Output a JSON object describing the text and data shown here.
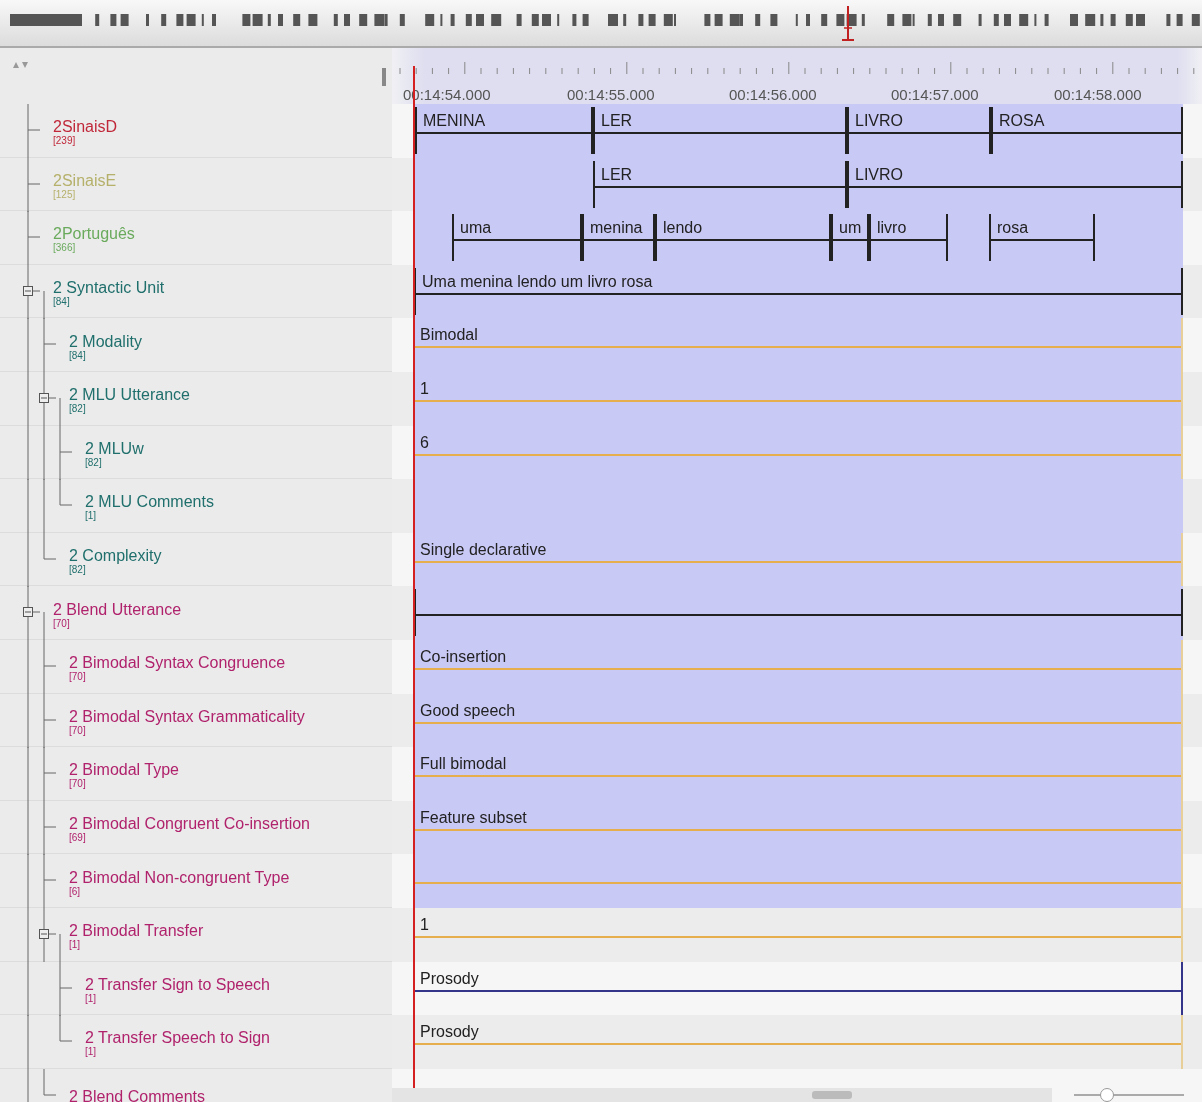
{
  "timeline": {
    "times": [
      "00:14:54.000",
      "00:14:55.000",
      "00:14:56.000",
      "00:14:57.000",
      "00:14:58.000"
    ]
  },
  "tiers": [
    {
      "name": "2SinaisD",
      "count": "[239]",
      "color": "#c0283a",
      "highlighted": true,
      "kind": "aligned",
      "annotations": [
        {
          "value": "MENINA"
        },
        {
          "value": "LER"
        },
        {
          "value": "LIVRO"
        },
        {
          "value": "ROSA"
        }
      ]
    },
    {
      "name": "2SinaisE",
      "count": "[125]",
      "color": "#b5b06a",
      "highlighted": true,
      "kind": "aligned",
      "annotations": [
        {
          "value": "LER"
        },
        {
          "value": "LIVRO"
        }
      ]
    },
    {
      "name": "2Português",
      "count": "[366]",
      "color": "#6aaa5c",
      "highlighted": true,
      "kind": "aligned",
      "annotations": [
        {
          "value": "uma"
        },
        {
          "value": "menina"
        },
        {
          "value": "lendo"
        },
        {
          "value": "um"
        },
        {
          "value": "livro"
        },
        {
          "value": "rosa"
        }
      ]
    },
    {
      "name": "2 Syntactic Unit",
      "count": "[84]",
      "color": "#1f6f6c",
      "highlighted": true,
      "kind": "aligned",
      "expanded": true,
      "annotations": [
        {
          "value": "Uma menina lendo um livro rosa"
        }
      ],
      "children": [
        {
          "name": "2 Modality",
          "count": "[84]",
          "color": "#1f6f6c",
          "highlighted": true,
          "kind": "reference",
          "annotations": [
            {
              "value": "Bimodal"
            }
          ]
        },
        {
          "name": "2 MLU Utterance",
          "count": "[82]",
          "color": "#1f6f6c",
          "highlighted": true,
          "kind": "reference",
          "expanded": true,
          "annotations": [
            {
              "value": "1"
            }
          ],
          "children": [
            {
              "name": "2 MLUw",
              "count": "[82]",
              "color": "#1f6f6c",
              "highlighted": true,
              "kind": "reference",
              "annotations": [
                {
                  "value": "6"
                }
              ]
            },
            {
              "name": "2 MLU Comments",
              "count": "[1]",
              "color": "#1f6f6c",
              "highlighted": true
            }
          ]
        },
        {
          "name": "2 Complexity",
          "count": "[82]",
          "color": "#1f6f6c",
          "highlighted": true,
          "kind": "reference",
          "annotations": [
            {
              "value": "Single declarative"
            }
          ]
        }
      ]
    },
    {
      "name": "2 Blend Utterance",
      "count": "[70]",
      "color": "#b0226c",
      "highlighted": true,
      "kind": "aligned",
      "expanded": true,
      "blank_annotation": true,
      "children": [
        {
          "name": "2 Bimodal Syntax Congruence",
          "count": "[70]",
          "color": "#b0226c",
          "highlighted": true,
          "kind": "reference",
          "annotations": [
            {
              "value": "Co-insertion"
            }
          ]
        },
        {
          "name": "2 Bimodal Syntax Grammaticality",
          "count": "[70]",
          "color": "#b0226c",
          "highlighted": true,
          "kind": "reference",
          "annotations": [
            {
              "value": "Good speech"
            }
          ]
        },
        {
          "name": "2 Bimodal Type",
          "count": "[70]",
          "color": "#b0226c",
          "highlighted": true,
          "kind": "reference",
          "annotations": [
            {
              "value": "Full bimodal"
            }
          ]
        },
        {
          "name": "2 Bimodal Congruent Co-insertion",
          "count": "[69]",
          "color": "#b0226c",
          "highlighted": true,
          "kind": "reference",
          "annotations": [
            {
              "value": "Feature subset"
            }
          ]
        },
        {
          "name": "2 Bimodal Non-congruent Type",
          "count": "[6]",
          "color": "#b0226c",
          "highlighted": true,
          "kind": "reference",
          "blank_annotation": true
        },
        {
          "name": "2 Bimodal Transfer",
          "count": "[1]",
          "color": "#b0226c",
          "highlighted": false,
          "kind": "reference",
          "expanded": true,
          "annotations": [
            {
              "value": "1"
            }
          ],
          "children": [
            {
              "name": "2 Transfer Sign to Speech",
              "count": "[1]",
              "color": "#b0226c",
              "highlighted": false,
              "kind": "included",
              "annotations": [
                {
                  "value": "Prosody"
                }
              ]
            },
            {
              "name": "2 Transfer Speech to Sign",
              "count": "[1]",
              "color": "#b0226c",
              "highlighted": false,
              "kind": "reference",
              "annotations": [
                {
                  "value": "Prosody"
                }
              ]
            }
          ]
        },
        {
          "name": "2 Blend Comments",
          "color": "#b0226c",
          "highlighted": false
        }
      ]
    }
  ],
  "zoom_slider": {
    "level": 0.3
  }
}
